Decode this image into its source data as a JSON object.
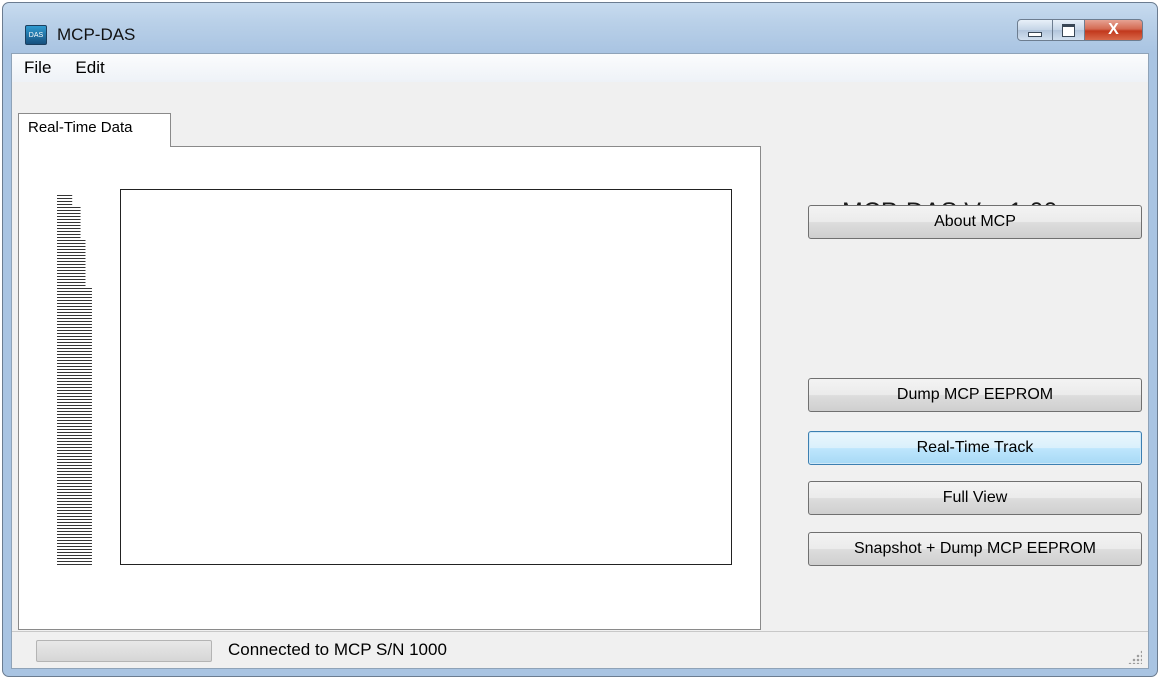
{
  "window": {
    "title": "MCP-DAS",
    "icon": "app-icon",
    "controls": {
      "minimize": "minimize-icon",
      "maximize": "maximize-icon",
      "close": "X"
    }
  },
  "menu": {
    "items": [
      "File",
      "Edit"
    ]
  },
  "tabs": [
    {
      "label": "Real-Time Data",
      "active": true
    }
  ],
  "right_panel": {
    "version": "MCP-DAS Ver 1.00",
    "buttons": {
      "about": "About MCP",
      "dump": "Dump MCP EEPROM",
      "realtime": "Real-Time Track",
      "fullview": "Full View",
      "snapshot": "Snapshot + Dump MCP EEPROM"
    }
  },
  "status": {
    "text": "Connected to MCP S/N 1000",
    "progress": 0
  },
  "colors": {
    "accent": "#3c7fb1",
    "titlebar": "#b9d0e8",
    "close_button": "#c2381c"
  }
}
